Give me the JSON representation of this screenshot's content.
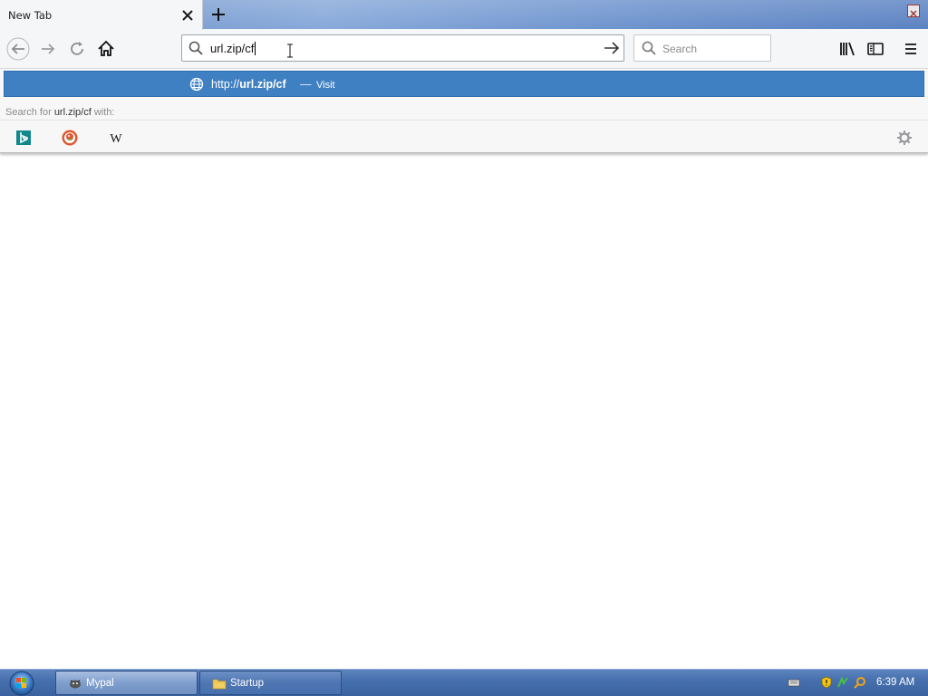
{
  "tab": {
    "title": "New Tab"
  },
  "toolbar": {
    "url_value": "url.zip/cf",
    "search_placeholder": "Search"
  },
  "autocomplete": {
    "url_prefix": "http://",
    "url_host": "url.zip/cf",
    "dash": "—",
    "action": "Visit",
    "search_for_prefix": "Search for",
    "search_for_term": "url.zip/cf",
    "search_for_suffix": "with:",
    "engines": [
      "bing",
      "duckduckgo",
      "wikipedia"
    ]
  },
  "taskbar": {
    "apps": [
      {
        "label": "Mypal",
        "active": true
      },
      {
        "label": "Startup",
        "active": false
      }
    ],
    "clock": "6:39 AM"
  },
  "colors": {
    "accent": "#3f80c2",
    "taskbar": "#4670ae",
    "tabstrip": "#7a9dd1"
  },
  "icons": {
    "nav": [
      "back-arrow-icon",
      "forward-arrow-icon",
      "reload-icon",
      "home-icon"
    ],
    "right": [
      "library-icon",
      "sidebar-icon",
      "menu-icon"
    ]
  }
}
